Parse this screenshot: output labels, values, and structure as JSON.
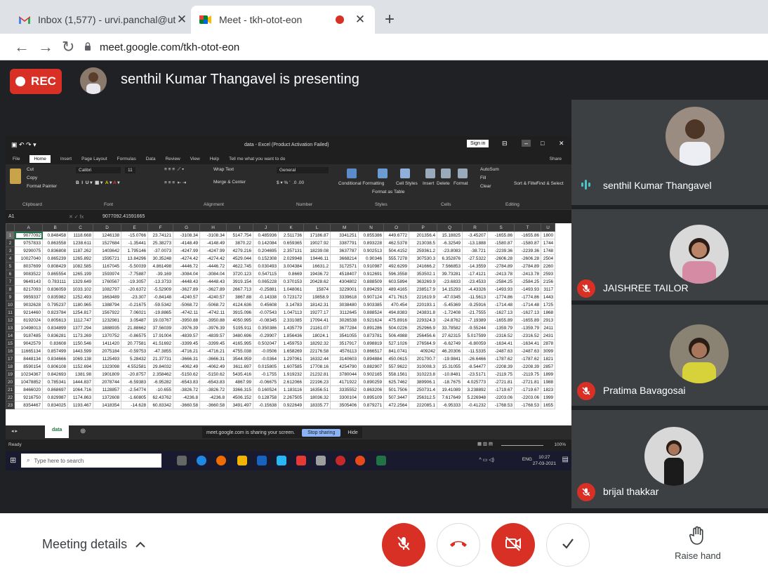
{
  "tabs": [
    {
      "title": "Inbox (1,577) - urvi.panchal@utu",
      "close": "✕"
    },
    {
      "title": "Meet - tkh-otot-eon",
      "close": "✕"
    }
  ],
  "new_tab": "+",
  "url": "meet.google.com/tkh-otot-eon",
  "rec_label": "REC",
  "presenting_text": "senthil Kumar Thangavel is presenting",
  "excel": {
    "doc_title": "data - Excel (Product Activation Failed)",
    "sign_in": "Sign in",
    "tabs": [
      "File",
      "Home",
      "Insert",
      "Page Layout",
      "Formulas",
      "Data",
      "Review",
      "View",
      "Help",
      "Tell me what you want to do"
    ],
    "share": "Share",
    "ribbon": {
      "cut": "Cut",
      "copy": "Copy",
      "format_painter": "Format Painter",
      "clipboard": "Clipboard",
      "font_name": "Calibri",
      "font_size": "11",
      "font": "Font",
      "wrap_text": "Wrap Text",
      "merge_center": "Merge & Center",
      "alignment": "Alignment",
      "number_format": "General",
      "number": "Number",
      "conditional": "Conditional Formatting",
      "format_table": "Format as Table",
      "cell_styles": "Cell Styles",
      "styles": "Styles",
      "insert": "Insert",
      "delete": "Delete",
      "format": "Format",
      "cells": "Cells",
      "autosum": "AutoSum",
      "fill": "Fill",
      "clear": "Clear",
      "sort_filter": "Sort & Filter",
      "find_select": "Find & Select",
      "editing": "Editing"
    },
    "name_box": "A1",
    "formula": "9077092.41591665",
    "columns": [
      "A",
      "B",
      "C",
      "D",
      "E",
      "F",
      "G",
      "H",
      "I",
      "J",
      "K",
      "L",
      "M",
      "N",
      "O",
      "P",
      "Q",
      "R",
      "S",
      "T",
      "U"
    ],
    "rows": [
      [
        "9077092",
        "0.848458",
        "1118.668",
        "1246138",
        "-15.0766",
        "23.74121",
        "-3108.34",
        "-3108.34",
        "5147.754",
        "0.485936",
        "2.511736",
        "17186.87",
        "3341251",
        "0.855386",
        "449.6772",
        "201356.4",
        "15.18825",
        "-3.45207",
        "-1655.86",
        "-1655.86",
        "1800"
      ],
      [
        "9757833",
        "0.863558",
        "1238.611",
        "1527684",
        "-1.35441",
        "25.38273",
        "-4148.49",
        "-4148.49",
        "3870.22",
        "0.142084",
        "0.659365",
        "19027.92",
        "3387791",
        "0.893228",
        "462.5378",
        "213038.5",
        "-6.32549",
        "-13.1888",
        "-1580.87",
        "-1580.87",
        "1744"
      ],
      [
        "9290075",
        "0.836808",
        "1187.262",
        "1403642",
        "1.795146",
        "-37.0073",
        "-4247.99",
        "-4247.99",
        "4279.216",
        "0.204695",
        "2.357131",
        "18239.08",
        "3637787",
        "0.902513",
        "504.4152",
        "259361.2",
        "-23.8083",
        "-38.721",
        "-2239.36",
        "-2239.36",
        "1748"
      ],
      [
        "10027040",
        "0.865239",
        "1265.892",
        "1595721",
        "13.84296",
        "30.35248",
        "-4274.42",
        "-4274.42",
        "4529.044",
        "0.152308",
        "2.029948",
        "19446.11",
        "3668214",
        "0.90346",
        "555.7278",
        "307530.3",
        "6.352876",
        "-27.5322",
        "-2606.28",
        "-2606.28",
        "2504"
      ],
      [
        "8037699",
        "0.808429",
        "1082.585",
        "1167045",
        "-5.50039",
        "4.861498",
        "-4446.72",
        "-4446.72",
        "4622.745",
        "0.030493",
        "3.004384",
        "16631.2",
        "3172571",
        "0.910987",
        "492.6299",
        "241666.2",
        "7.566853",
        "-14.3559",
        "-2784.89",
        "-2784.89",
        "2260"
      ],
      [
        "9083522",
        "0.865554",
        "1265.199",
        "1593974",
        "-7.75887",
        "-39.169",
        "-3084.04",
        "-3084.04",
        "3720.123",
        "0.547115",
        "0.8669",
        "19436.72",
        "4518407",
        "0.912691",
        "596.3558",
        "353502.1",
        "39.73281",
        "-17.4121",
        "-2413.78",
        "-2413.78",
        "2593"
      ],
      [
        "9649143",
        "0.783111",
        "1329.649",
        "1760567",
        "-19.3057",
        "-13.3733",
        "-4448.43",
        "-4448.43",
        "3919.154",
        "0.065228",
        "0.370153",
        "20428.62",
        "4304802",
        "0.888509",
        "603.5894",
        "363269.9",
        "-23.6833",
        "-23.4533",
        "-2584.25",
        "-2584.25",
        "2156"
      ],
      [
        "8217093",
        "0.836059",
        "1033.102",
        "1082797",
        "-20.6372",
        "-5.52909",
        "-3627.89",
        "-3627.89",
        "2667.713",
        "-0.25881",
        "1.048061",
        "15874",
        "3229001",
        "0.894293",
        "489.4165",
        "238517.9",
        "14.15293",
        "-4.43326",
        "-1493.93",
        "-1493.93",
        "3117"
      ],
      [
        "9959337",
        "0.835982",
        "1252.493",
        "1663489",
        "-23.307",
        "-0.84148",
        "-4240.57",
        "-4240.57",
        "3867.88",
        "-0.14338",
        "0.723172",
        "19858.9",
        "3339618",
        "0.907124",
        "471.7615",
        "221619.9",
        "-47.0345",
        "-11.5613",
        "-1774.86",
        "-1774.86",
        "1443"
      ],
      [
        "9032628",
        "0.795237",
        "1180.965",
        "1388794",
        "-0.21675",
        "-59.5342",
        "-5068.72",
        "-5068.72",
        "4124.636",
        "0.45608",
        "3.14783",
        "18142.31",
        "3038480",
        "0.903385",
        "470.454",
        "220193.1",
        "-5.45369",
        "-9.25916",
        "-1714.48",
        "-1714.48",
        "1725"
      ],
      [
        "9214460",
        "0.823784",
        "1254.817",
        "1567922",
        "7.06021",
        "-19.8865",
        "-4742.11",
        "-4742.11",
        "3915.096",
        "-0.07543",
        "1.047113",
        "19277.17",
        "3112645",
        "0.888524",
        "494.8383",
        "243831.8",
        "-1.72408",
        "-21.7555",
        "-1627.13",
        "-1627.13",
        "1868"
      ],
      [
        "8192024",
        "0.805613",
        "1112.747",
        "1232981",
        "3.05487",
        "19.03767",
        "-3950.88",
        "-3950.88",
        "4050.995",
        "-0.08345",
        "2.331085",
        "17094.41",
        "3026538",
        "0.921624",
        "475.8916",
        "229324.3",
        "-24.8762",
        "-7.19389",
        "-1655.89",
        "-1655.89",
        "2913"
      ],
      [
        "10498013",
        "0.834899",
        "1377.294",
        "1888935",
        "21.88662",
        "37.56039",
        "-3976.39",
        "-3976.39",
        "5195.911",
        "0.350386",
        "1.435779",
        "21161.07",
        "3677284",
        "0.891286",
        "504.0226",
        "252966.9",
        "33.78582",
        "-9.55244",
        "-1359.79",
        "-1359.79",
        "2411"
      ],
      [
        "9187485",
        "0.836281",
        "1173.269",
        "1370752",
        "-0.86575",
        "17.91004",
        "-4839.57",
        "-4839.57",
        "3480.696",
        "-0.29907",
        "1.856436",
        "18024.1",
        "3541055",
        "0.873781",
        "506.4988",
        "256456.6",
        "27.62315",
        "5.017599",
        "-2316.52",
        "-2316.52",
        "2431"
      ],
      [
        "9042579",
        "0.83608",
        "1150.546",
        "1411420",
        "20.77581",
        "41.51692",
        "-3399.45",
        "-3399.45",
        "4165.995",
        "0.502047",
        "1.459753",
        "18292.32",
        "3517917",
        "0.898819",
        "527.1026",
        "276564.9",
        "-6.62749",
        "-6.80059",
        "-1634.41",
        "-1634.41",
        "2878"
      ],
      [
        "11665134",
        "0.857499",
        "1443.599",
        "2075184",
        "-0.59753",
        "-47.3855",
        "-4716.21",
        "-4716.21",
        "4755.038",
        "-0.0506",
        "1.658269",
        "22176.58",
        "4576113",
        "0.866517",
        "841.0741",
        "409242",
        "46.20306",
        "-11.5335",
        "-2487.63",
        "-2487.63",
        "3099"
      ],
      [
        "8448134",
        "0.834666",
        "1069.138",
        "1125493",
        "5.28432",
        "21.37731",
        "-3666.31",
        "-3666.31",
        "3544.959",
        "-0.0364",
        "1.297061",
        "16332.44",
        "3140603",
        "0.894884",
        "450.0615",
        "201700.7",
        "-19.9841",
        "-26.6466",
        "-1787.62",
        "-1787.62",
        "1821"
      ],
      [
        "8590154",
        "0.806108",
        "1152.694",
        "1323098",
        "4.552581",
        "29.84032",
        "-4062.49",
        "-4062.49",
        "3611.697",
        "0.015805",
        "1.607585",
        "17708.16",
        "4254790",
        "0.882907",
        "557.9622",
        "310008.3",
        "15.31055",
        "-8.54477",
        "-2208.39",
        "-2208.39",
        "2857"
      ],
      [
        "10234367",
        "0.842693",
        "1381.98",
        "1901809",
        "-20.8757",
        "2.358462",
        "-5150.62",
        "-5150.62",
        "5435.416",
        "-0.1755",
        "1.919232",
        "21232.81",
        "3780044",
        "0.902165",
        "558.1561",
        "310223.8",
        "-10.8481",
        "-23.5171",
        "-2119.75",
        "-2119.75",
        "1899"
      ],
      [
        "10478852",
        "0.785341",
        "1444.837",
        "2078744",
        "-6.59383",
        "-6.95282",
        "-6543.83",
        "-6543.83",
        "4867.99",
        "-0.06675",
        "2.612066",
        "22196.23",
        "4171922",
        "0.890259",
        "625.7462",
        "389906.1",
        "-18.7675",
        "4.025773",
        "-2721.81",
        "-2721.81",
        "1988"
      ],
      [
        "8466020",
        "0.868697",
        "1064.716",
        "1128857",
        "-2.54774",
        "-10.655",
        "-3826.72",
        "-3826.72",
        "3366.315",
        "0.160524",
        "1.183116",
        "16356.51",
        "3335552",
        "0.863206",
        "501.7506",
        "250731.4",
        "19.41089",
        "3.238892",
        "-1719.67",
        "-1719.67",
        "1823"
      ],
      [
        "9216750",
        "0.829987",
        "1174.863",
        "1372608",
        "-1.60805",
        "62.43762",
        "-4236.8",
        "-4236.8",
        "4506.152",
        "0.128758",
        "2.267505",
        "18036.32",
        "3300104",
        "0.895109",
        "507.3447",
        "256312.5",
        "7.617649",
        "5.226948",
        "-2203.06",
        "-2203.06",
        "1999"
      ],
      [
        "8354467",
        "0.834025",
        "1193.467",
        "1418354",
        "-14.628",
        "60.83342",
        "-3660.58",
        "-3660.58",
        "3491.497",
        "-0.15638",
        "0.922649",
        "18335.77",
        "3505406",
        "0.879271",
        "472.2564",
        "222085.1",
        "-6.95333",
        "-0.41232",
        "-1768.53",
        "-1768.53",
        "1655"
      ]
    ],
    "sheet_name": "data",
    "sharing_text": "meet.google.com is sharing your screen.",
    "stop_sharing": "Stop sharing",
    "hide": "Hide",
    "status_ready": "Ready",
    "zoom": "100%",
    "taskbar_search": "Type here to search",
    "lang": "ENG",
    "time": "10:27",
    "date": "27-03-2021"
  },
  "participants": [
    {
      "name": "senthil Kumar Thangavel",
      "state": "speaking"
    },
    {
      "name": "JAISHREE TAILOR",
      "state": "muted"
    },
    {
      "name": "Pratima Bavagosai",
      "state": "muted"
    },
    {
      "name": "brijal thakkar",
      "state": "muted"
    }
  ],
  "bottom": {
    "meeting_details": "Meeting details",
    "raise_hand": "Raise hand"
  },
  "colors": {
    "danger": "#d93025",
    "stage": "#202124",
    "tile": "#3c4043",
    "speaking": "#4cc3c3"
  }
}
